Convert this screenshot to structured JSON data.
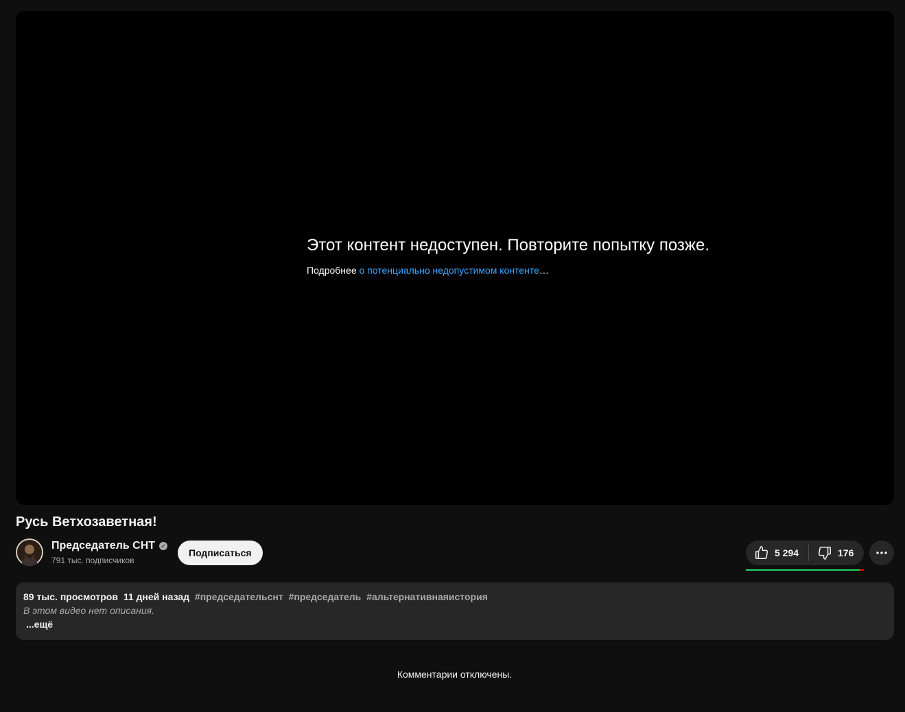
{
  "player": {
    "error_title": "Этот контент недоступен. Повторите попытку позже.",
    "error_prefix": "Подробнее ",
    "error_link": "о потенциально недопустимом контенте",
    "error_suffix": "…"
  },
  "video": {
    "title": "Русь Ветхозаветная!"
  },
  "channel": {
    "name": "Председатель СНТ",
    "subscribers": "791 тыс. подписчиков",
    "verified_icon": "verified-badge-icon"
  },
  "actions": {
    "subscribe_label": "Подписаться",
    "like_count": "5 294",
    "dislike_count": "176",
    "like_ratio": 0.968
  },
  "description": {
    "views": "89 тыс. просмотров",
    "date": "11 дней назад",
    "hashtags": [
      "#председательснт",
      "#председатель",
      "#альтернативнаяистория"
    ],
    "empty_text": "В этом видео нет описания.",
    "more_label": "...ещё"
  },
  "comments": {
    "status": "Комментарии отключены."
  },
  "colors": {
    "background": "#0f0f0f",
    "link": "#3ea6ff",
    "like_bar": "#1ed760",
    "dislike_bar": "#ff0000"
  }
}
